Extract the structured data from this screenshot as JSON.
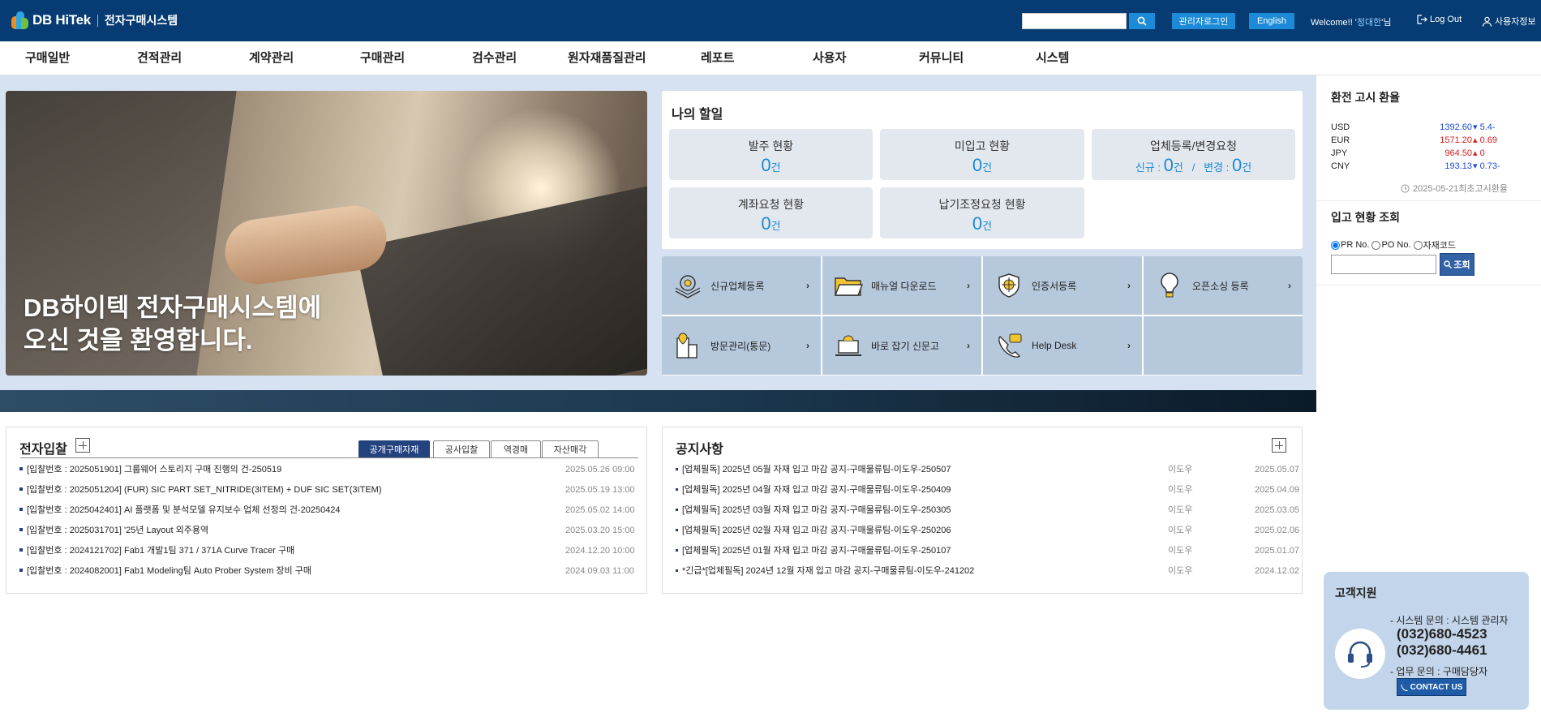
{
  "header": {
    "brand": "DB HiTek",
    "system_name": "전자구매시스템",
    "search_placeholder": "",
    "admin_login": "관리자로그인",
    "english": "English",
    "welcome_prefix": "Welcome!! '",
    "user_name": "정대한",
    "welcome_suffix": "'님",
    "logout": "Log Out",
    "user_info": "사용자정보"
  },
  "nav": [
    "구매일반",
    "견적관리",
    "계약관리",
    "구매관리",
    "검수관리",
    "원자재품질관리",
    "레포트",
    "사용자",
    "커뮤니티",
    "시스템"
  ],
  "hero": {
    "title": "DB하이텍 전자구매시스템에\n오신 것을 환영합니다."
  },
  "tasks": {
    "title": "나의 할일",
    "unit": "건",
    "items": [
      {
        "label": "발주 현황",
        "value": "0"
      },
      {
        "label": "미입고 현황",
        "value": "0"
      },
      {
        "label": "업체등록/변경요청",
        "new_label": "신규 :",
        "new_value": "0",
        "change_label": "변경 :",
        "change_value": "0",
        "sep": "/"
      },
      {
        "label": "계좌요청 현황",
        "value": "0"
      },
      {
        "label": "납기조정요청 현황",
        "value": "0"
      }
    ]
  },
  "quick": [
    {
      "label": "신규업체등록",
      "icon": "gear-document-icon"
    },
    {
      "label": "매뉴얼 다운로드",
      "icon": "folder-icon"
    },
    {
      "label": "인증서등록",
      "icon": "certificate-icon"
    },
    {
      "label": "오픈소싱 등록",
      "icon": "lightbulb-icon"
    },
    {
      "label": "방문관리(통문)",
      "icon": "building-pin-icon"
    },
    {
      "label": "바로 잡기 신문고",
      "icon": "alarm-laptop-icon"
    },
    {
      "label": "Help Desk",
      "icon": "phone-chat-icon"
    }
  ],
  "exchange": {
    "title": "환전 고시 환율",
    "rates": [
      {
        "currency": "USD",
        "value": "1392.60",
        "dir": "down",
        "delta": "5.4-",
        "color": "#1c4bd6"
      },
      {
        "currency": "EUR",
        "value": "1571.20",
        "dir": "up",
        "delta": "0.69",
        "color": "#d61c1c"
      },
      {
        "currency": "JPY",
        "value": "964.50",
        "dir": "up",
        "delta": "0",
        "color": "#d61c1c"
      },
      {
        "currency": "CNY",
        "value": "193.13",
        "dir": "down",
        "delta": "0.73-",
        "color": "#1c4bd6"
      }
    ],
    "date": "2025-05-21최초고시환율"
  },
  "stock": {
    "title": "입고 현황 조회",
    "options": [
      "PR No.",
      "PO No.",
      "자재코드"
    ],
    "button": "조회"
  },
  "support": {
    "title": "고객지원",
    "system_line": "- 시스템 문의 : 시스템 관리자",
    "phone1": "(032)680-4523",
    "phone2": "(032)680-4461",
    "biz_line": "- 업무 문의 : 구매담당자",
    "contact": "CONTACT US"
  },
  "bids": {
    "title": "전자입찰",
    "tabs": [
      "공개구매자재",
      "공사입찰",
      "역경매",
      "자산매각"
    ],
    "rows": [
      {
        "text": "[입찰번호 : 2025051901] 그룹웨어 스토리지 구매 진행의 건-250519",
        "date": "2025.05.26 09:00"
      },
      {
        "text": "[입찰번호 : 2025051204] (FUR) SIC PART SET_NITRIDE(3ITEM) + DUF SIC SET(3ITEM)",
        "date": "2025.05.19 13:00"
      },
      {
        "text": "[입찰번호 : 2025042401] AI 플랫폼 및 분석모델 유지보수 업체 선정의 건-20250424",
        "date": "2025.05.02 14:00"
      },
      {
        "text": "[입찰번호 : 2025031701] '25년 Layout 외주용역",
        "date": "2025.03.20 15:00"
      },
      {
        "text": "[입찰번호 : 2024121702] Fab1 개발1팀 371 / 371A Curve Tracer 구매",
        "date": "2024.12.20 10:00"
      },
      {
        "text": "[입찰번호 : 2024082001] Fab1 Modeling팀 Auto Prober System 장비 구매",
        "date": "2024.09.03 11:00"
      }
    ]
  },
  "notices": {
    "title": "공지사항",
    "rows": [
      {
        "text": "[업체필독] 2025년 05월 자재 입고 마감 공지-구매물류팀-이도우-250507",
        "author": "이도우",
        "date": "2025.05.07"
      },
      {
        "text": "[업체필독] 2025년 04월 자재 입고 마감 공지-구매물류팀-이도우-250409",
        "author": "이도우",
        "date": "2025.04.09"
      },
      {
        "text": "[업체필독] 2025년 03월 자재 입고 마감 공지-구매물류팀-이도우-250305",
        "author": "이도우",
        "date": "2025.03.05"
      },
      {
        "text": "[업체필독] 2025년 02월 자재 입고 마감 공지-구매물류팀-이도우-250206",
        "author": "이도우",
        "date": "2025.02.06"
      },
      {
        "text": "[업체필독] 2025년 01월 자재 입고 마감 공지-구매물류팀-이도우-250107",
        "author": "이도우",
        "date": "2025.01.07"
      },
      {
        "text": "*긴급*[업체필독] 2024년 12월 자재 입고 마감 공지-구매물류팀-이도우-241202",
        "author": "이도우",
        "date": "2024.12.02"
      }
    ]
  }
}
